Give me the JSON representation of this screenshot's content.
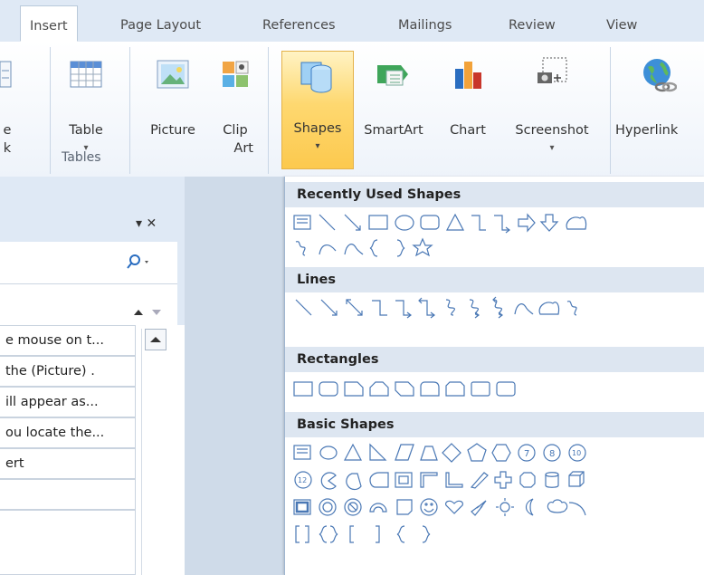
{
  "tabs": [
    "Insert",
    "Page Layout",
    "References",
    "Mailings",
    "Review",
    "View"
  ],
  "ribbon": {
    "left_partial": [
      "e",
      "k"
    ],
    "table": "Table",
    "tables_group": "Tables",
    "picture": "Picture",
    "clip_art_1": "Clip",
    "clip_art_2": "Art",
    "shapes": "Shapes",
    "smartart": "SmartArt",
    "chart": "Chart",
    "screenshot": "Screenshot",
    "hyperlink": "Hyperlink"
  },
  "pane": {
    "close_glyph": "▾ ✕",
    "rows": [
      "e mouse on t...",
      "the (Picture) .",
      "ill appear as...",
      "ou locate the...",
      "ert",
      "",
      ""
    ]
  },
  "gallery": {
    "recent": "Recently Used Shapes",
    "lines": "Lines",
    "rectangles": "Rectangles",
    "basic": "Basic Shapes"
  },
  "colors": {
    "accent": "#fed870",
    "ribbon_bg": "#dfe9f5",
    "section_bg": "#dde6f1",
    "shape_stroke": "#4a78b5"
  }
}
